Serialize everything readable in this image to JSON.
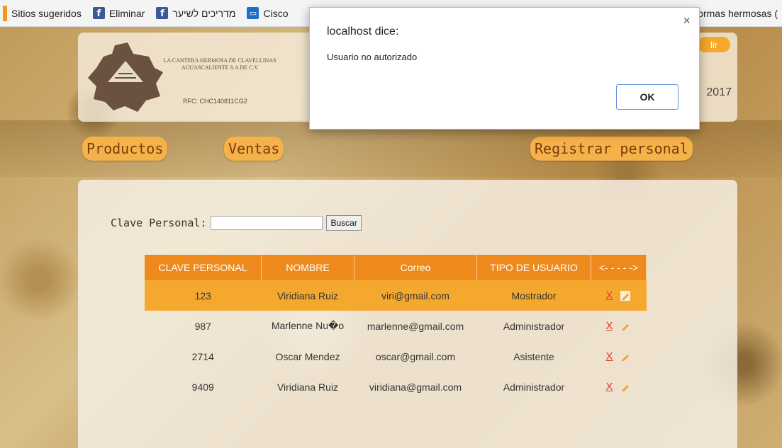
{
  "bookmarks": {
    "items": [
      {
        "label": "Sitios sugeridos"
      },
      {
        "label": "Eliminar",
        "icon": "facebook-icon"
      },
      {
        "label": "מדריכים לשיער",
        "icon": "facebook-icon"
      },
      {
        "label": "Cisco",
        "icon": "cisco-icon"
      }
    ],
    "right_label": "formas hermosas ("
  },
  "header": {
    "company_line1": "LA CANTERA HERMOSA DE CLAVELLINAS",
    "company_line2": "AGUASCALIENTE S.A DE C.V",
    "rfc": "RFC: CHC140811CG2",
    "year": "2017",
    "salir_label": "lir"
  },
  "nav": {
    "productos": "Productos",
    "ventas": "Ventas",
    "registrar": "Registrar personal"
  },
  "search": {
    "label": "Clave Personal:",
    "value": "",
    "button": "Buscar"
  },
  "table": {
    "headers": [
      "CLAVE PERSONAL",
      "NOMBRE",
      "Correo",
      "TIPO DE USUARIO",
      "<- - - - ->"
    ],
    "rows": [
      {
        "clave": "123",
        "nombre": "Viridiana Ruiz",
        "correo": "viri@gmail.com",
        "tipo": "Mostrador",
        "delete": "X"
      },
      {
        "clave": "987",
        "nombre": "Marlenne Nu�o",
        "correo": "marlenne@gmail.com",
        "tipo": "Administrador",
        "delete": "X"
      },
      {
        "clave": "2714",
        "nombre": "Oscar Mendez",
        "correo": "oscar@gmail.com",
        "tipo": "Asistente",
        "delete": "X"
      },
      {
        "clave": "9409",
        "nombre": "Viridiana Ruiz",
        "correo": "viridiana@gmail.com",
        "tipo": "Administrador",
        "delete": "X"
      }
    ]
  },
  "dialog": {
    "title": "localhost dice:",
    "message": "Usuario no autorizado",
    "ok": "OK",
    "close": "×"
  }
}
